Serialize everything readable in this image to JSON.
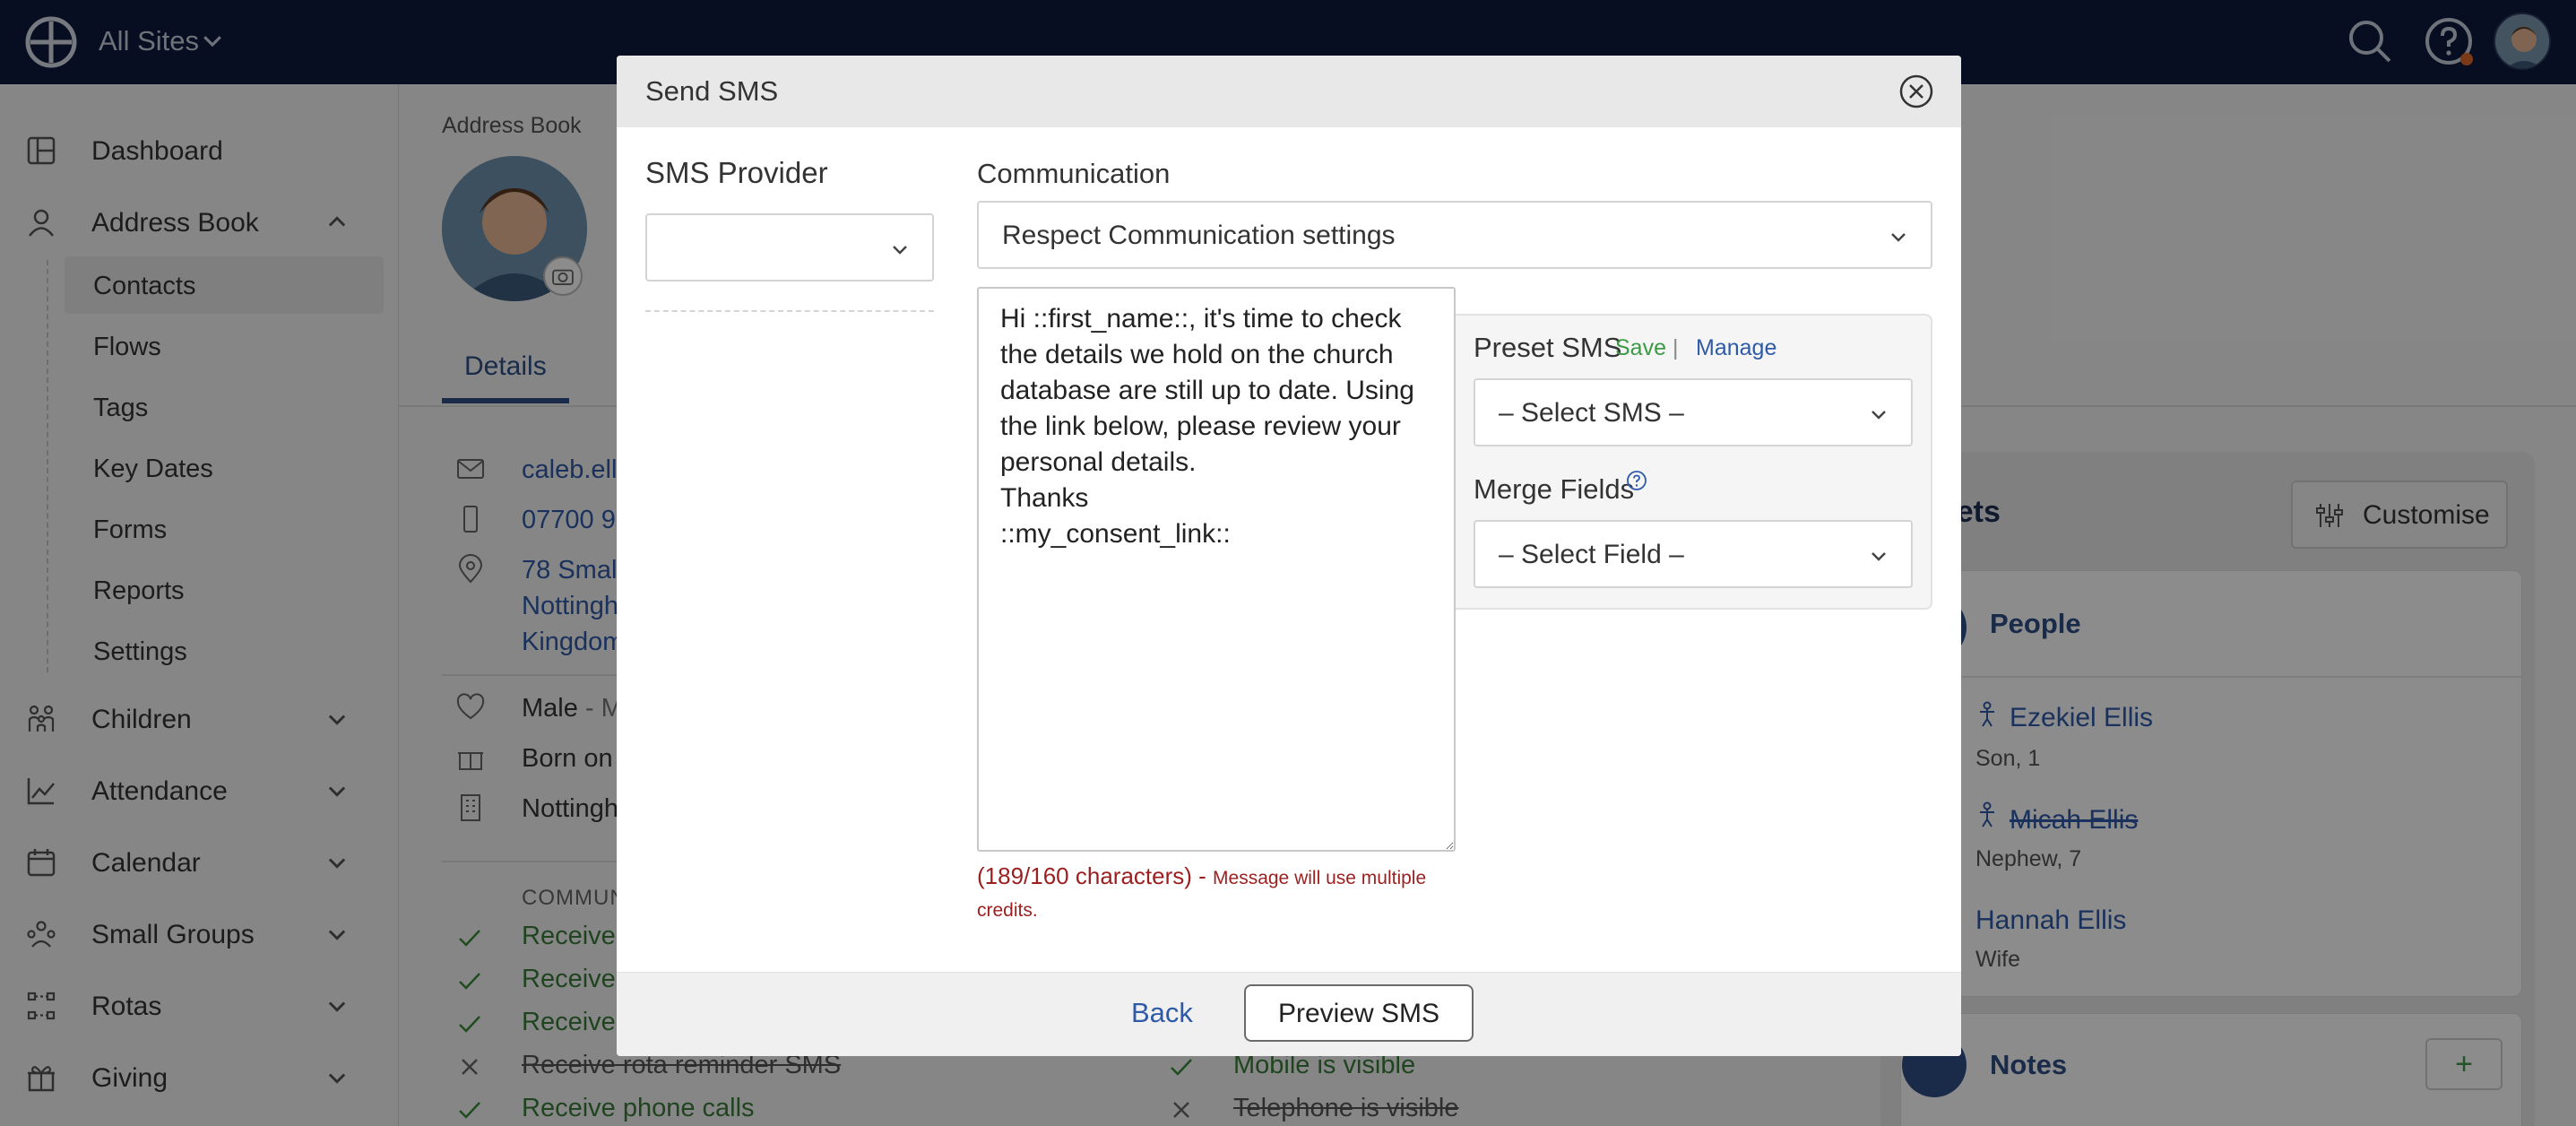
{
  "topbar": {
    "sites_label": "All Sites"
  },
  "sidebar": {
    "items": [
      {
        "label": "Dashboard"
      },
      {
        "label": "Address Book"
      },
      {
        "label": "Children"
      },
      {
        "label": "Attendance"
      },
      {
        "label": "Calendar"
      },
      {
        "label": "Small Groups"
      },
      {
        "label": "Rotas"
      },
      {
        "label": "Giving"
      }
    ],
    "subitems": [
      {
        "label": "Contacts"
      },
      {
        "label": "Flows"
      },
      {
        "label": "Tags"
      },
      {
        "label": "Key Dates"
      },
      {
        "label": "Forms"
      },
      {
        "label": "Reports"
      },
      {
        "label": "Settings"
      }
    ]
  },
  "profile": {
    "breadcrumb": "Address Book",
    "tab_details": "Details",
    "email": "caleb.ell",
    "phone": "07700 9",
    "address_line1": "78 Smal",
    "address_line2": "Nottingh",
    "address_line3": "Kingdom",
    "gender": "Male",
    "gender_sep": " - M",
    "born": "Born on",
    "location": "Nottingh",
    "comm_heading": "COMMUN",
    "comm_rows": [
      {
        "text": "Receive"
      },
      {
        "text": "Receive"
      },
      {
        "text": "Receive"
      },
      {
        "text": "Receive rota reminder SMS"
      },
      {
        "text": "Receive phone calls"
      }
    ],
    "visibility": [
      {
        "text": "Mobile is visible"
      },
      {
        "text": "Telephone is visible"
      }
    ]
  },
  "widgets": {
    "title": "gets",
    "customise_label": "Customise",
    "people_title": "People",
    "people": [
      {
        "name": "Ezekiel Ellis",
        "relation": "Son, 1"
      },
      {
        "name": "Micah Ellis",
        "relation": "Nephew, 7"
      },
      {
        "name": "Hannah Ellis",
        "relation": "Wife"
      }
    ],
    "notes_title": "Notes",
    "notes_add": "+"
  },
  "modal": {
    "title": "Send SMS",
    "provider_label": "SMS Provider",
    "provider_value": "",
    "communication_label": "Communication",
    "communication_value": "Respect Communication settings",
    "message": "Hi ::first_name::, it's time to check the details we hold on the church database are still up to date. Using the link below, please review your personal details.\nThanks\n::my_consent_link::",
    "preset_label": "Preset SMS",
    "preset_save": "Save",
    "preset_sep": "|",
    "preset_manage": "Manage",
    "preset_value": "– Select SMS –",
    "merge_label": "Merge Fields",
    "merge_value": "– Select Field –",
    "char_count": "(189/160 characters) -",
    "char_warning": "Message will use multiple",
    "char_warning2": "credits.",
    "back_label": "Back",
    "preview_label": "Preview SMS"
  }
}
